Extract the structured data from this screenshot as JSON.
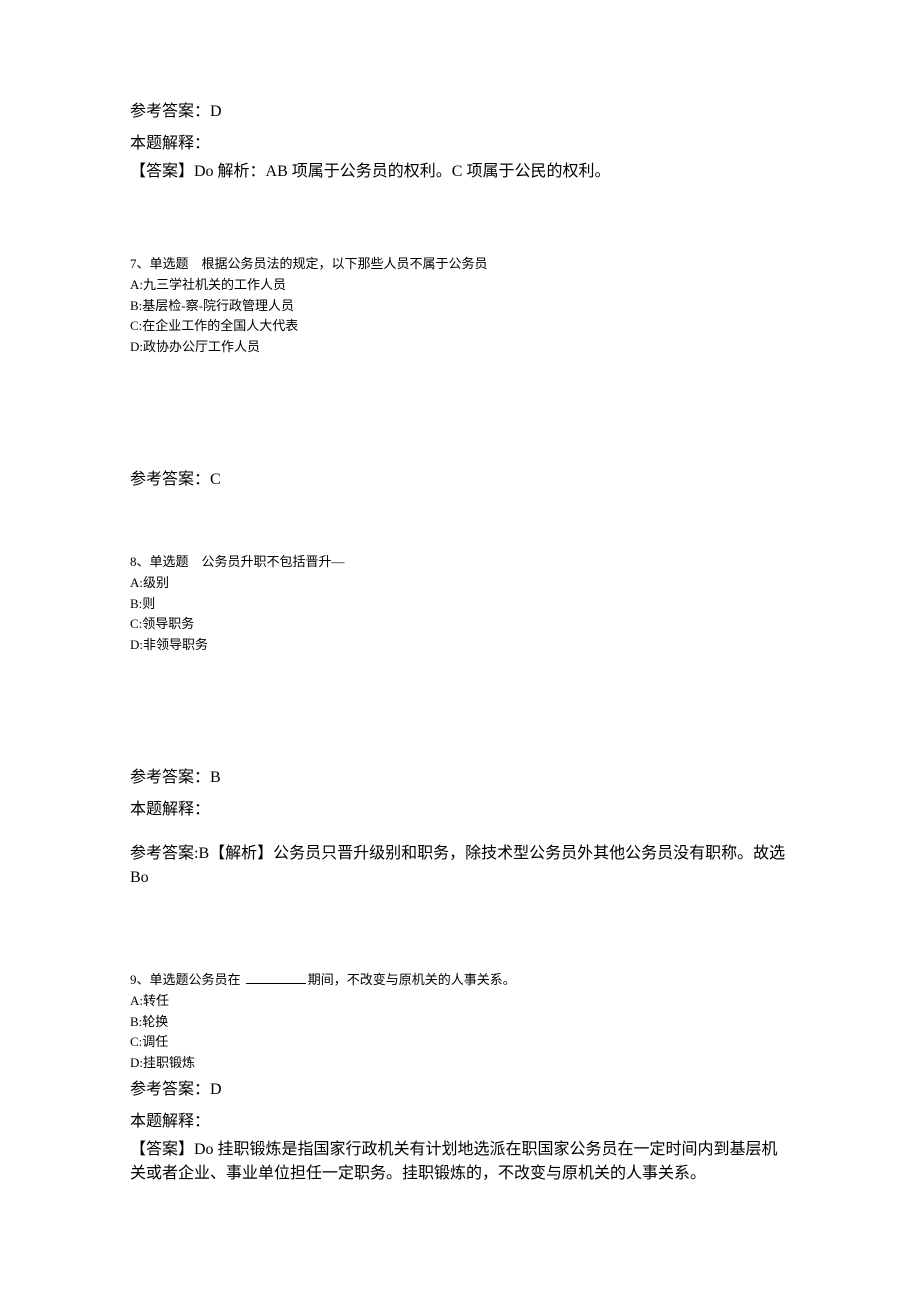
{
  "q6": {
    "answer_label": "参考答案：",
    "answer_value": "D",
    "explain_label": "本题解释：",
    "explain_text": "【答案】Do 解析：AB 项属于公务员的权利。C 项属于公民的权利。"
  },
  "q7": {
    "number": "7、",
    "type": "单选题",
    "stem": "根据公务员法的规定，以下那些人员不属于公务员",
    "optA": "A:九三学社机关的工作人员",
    "optB": "B:基层检-察-院行政管理人员",
    "optC": "C:在企业工作的全国人大代表",
    "optD": "D:政协办公厅工作人员",
    "answer_label": "参考答案：",
    "answer_value": "C"
  },
  "q8": {
    "number": "8、",
    "type": "单选题",
    "stem": "公务员升职不包括晋升—",
    "optA": "A:级别",
    "optB": "B:则",
    "optC": "C:领导职务",
    "optD": "D:非领导职务",
    "answer_label": "参考答案：",
    "answer_value": "B",
    "explain_label": "本题解释：",
    "explain_text": "参考答案:B【解析】公务员只晋升级别和职务，除技术型公务员外其他公务员没有职称。故选 Bo"
  },
  "q9": {
    "number": "9、",
    "type": "单选题",
    "stem_pre": "公务员在 ",
    "stem_post": "期间，不改变与原机关的人事关系。",
    "optA": "A:转任",
    "optB": "B:轮换",
    "optC": "C:调任",
    "optD": "D:挂职锻炼",
    "answer_label": "参考答案：",
    "answer_value": "D",
    "explain_label": "本题解释：",
    "explain_text": "【答案】Do 挂职锻炼是指国家行政机关有计划地选派在职国家公务员在一定时间内到基层机关或者企业、事业单位担任一定职务。挂职锻炼的，不改变与原机关的人事关系。"
  }
}
